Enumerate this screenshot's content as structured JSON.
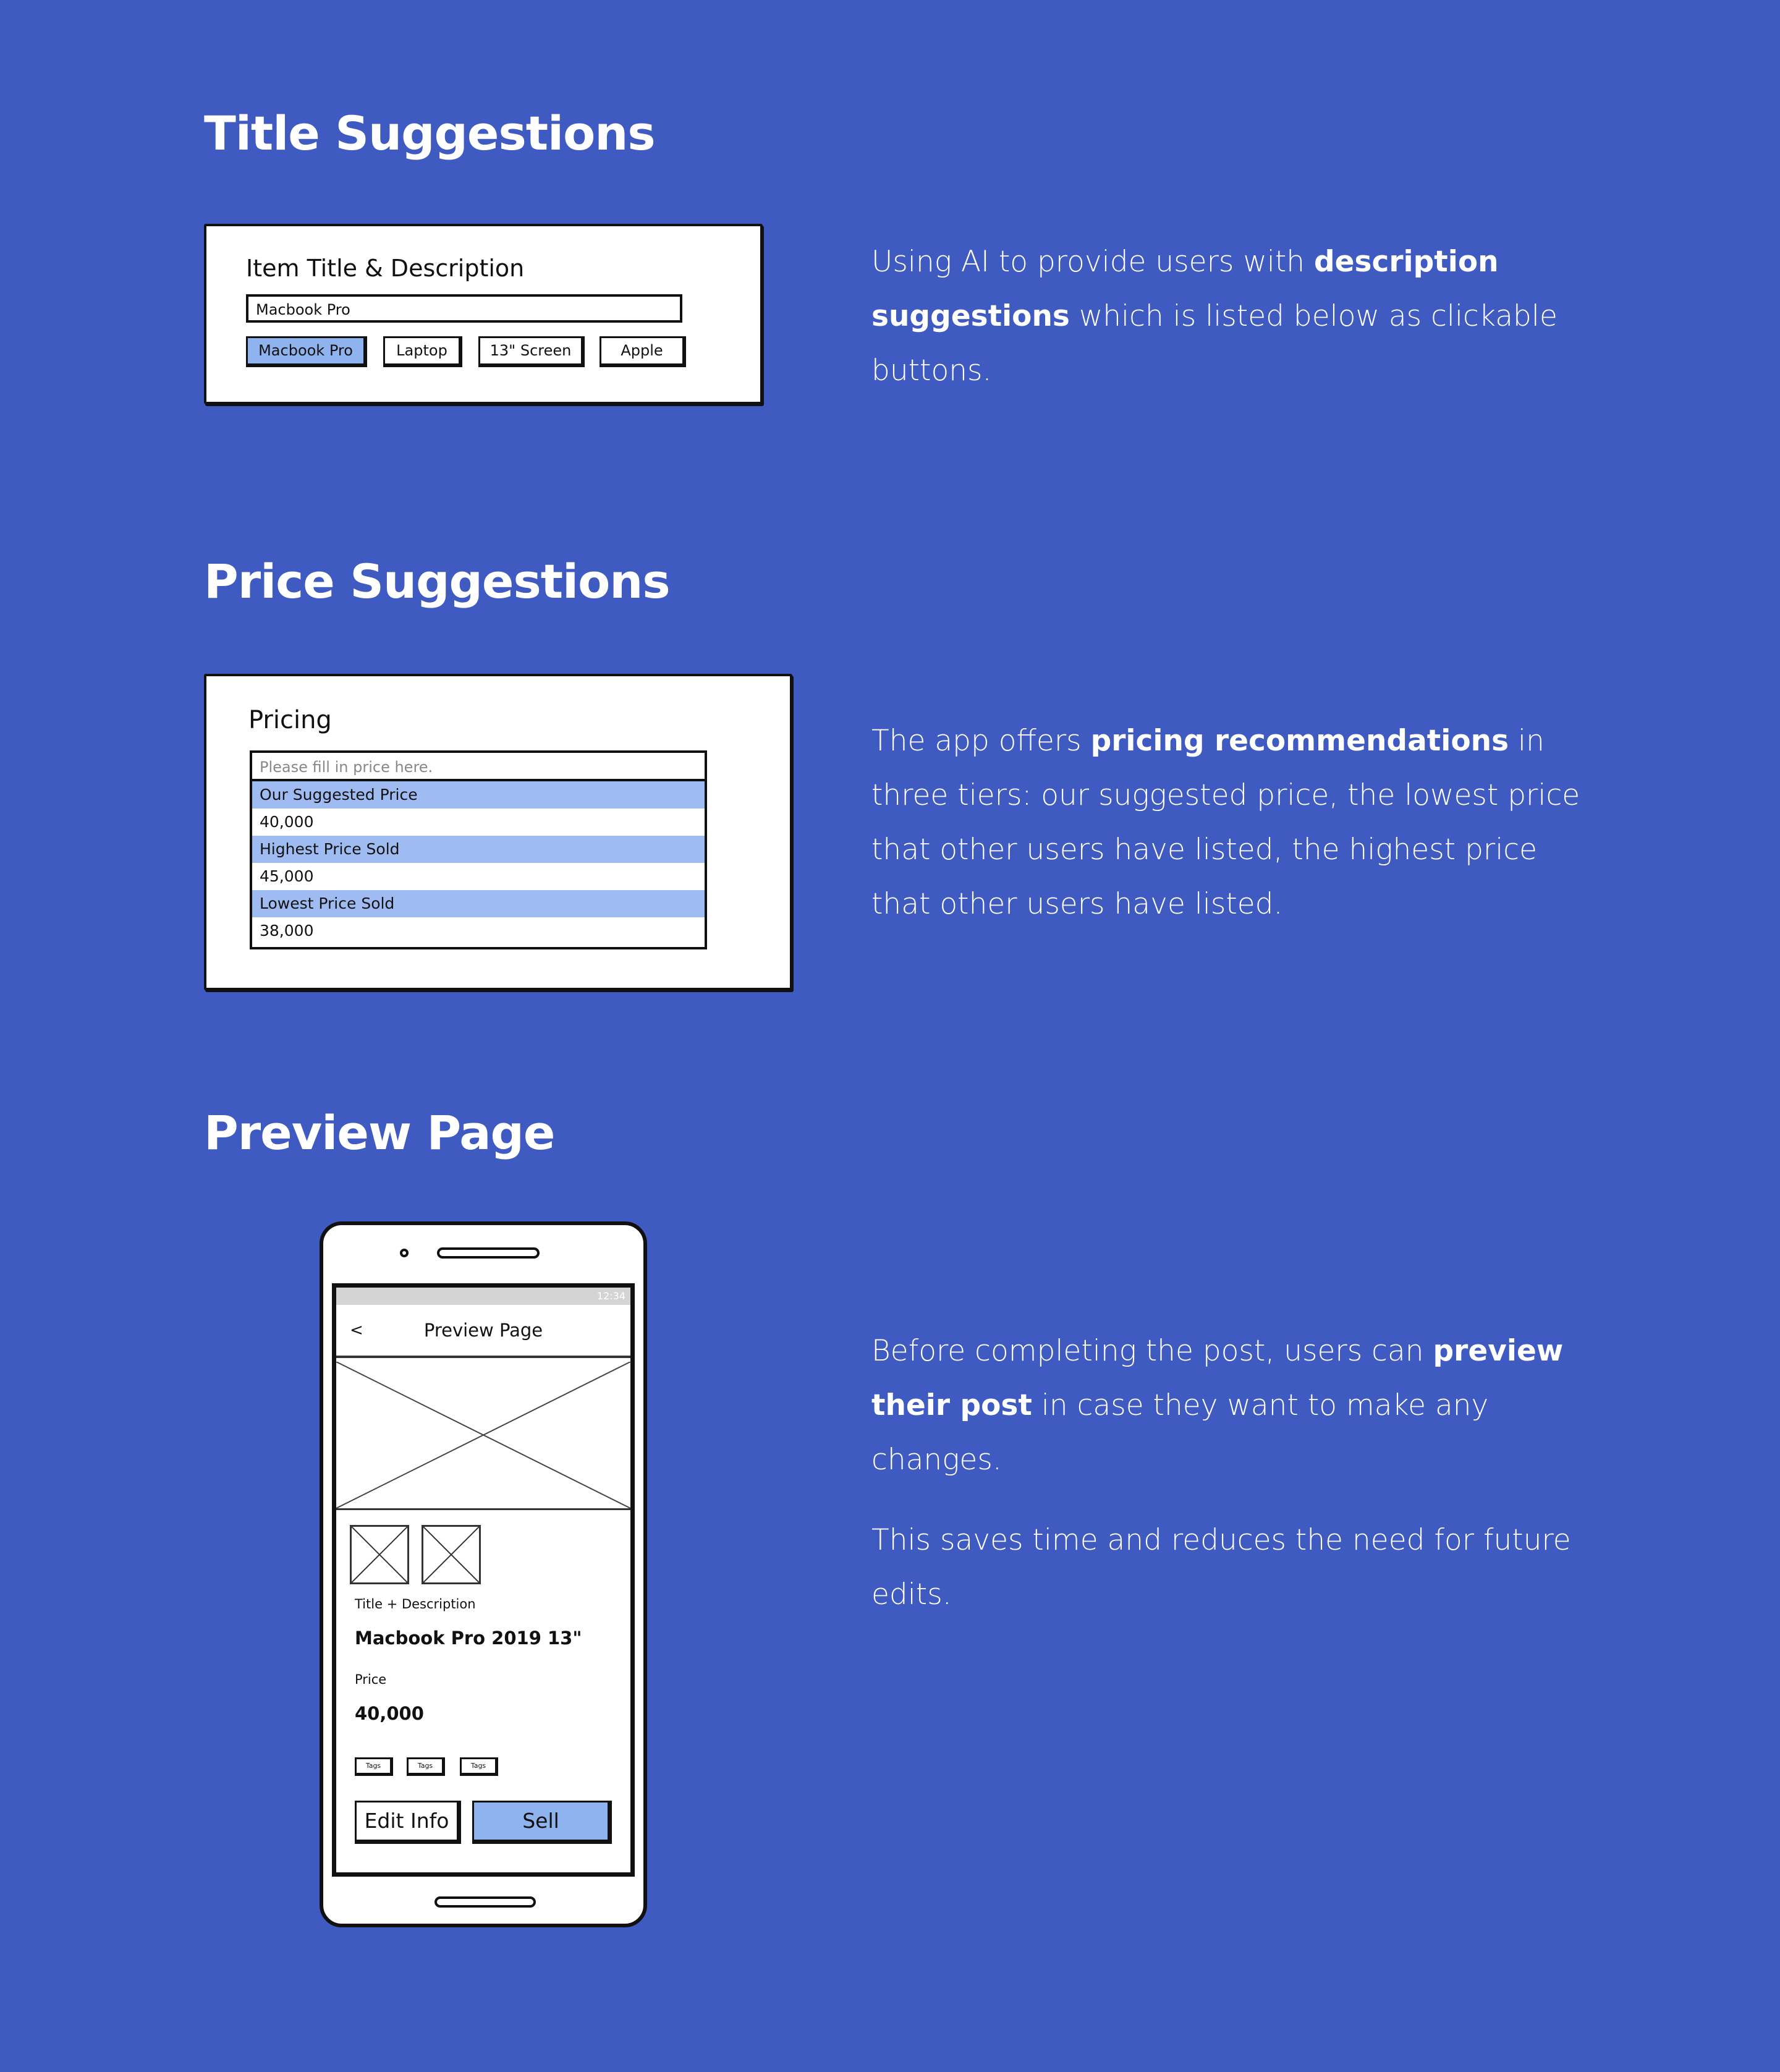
{
  "sections": {
    "title": {
      "heading": "Title Suggestions",
      "card_label": "Item Title & Description",
      "input_value": "Macbook Pro",
      "chips": [
        "Macbook Pro",
        "Laptop",
        "13\" Screen",
        "Apple"
      ],
      "desc_pre": "Using AI to provide users with ",
      "desc_bold": "description suggestions",
      "desc_post": " which is listed below as clickable buttons."
    },
    "price": {
      "heading": "Price Suggestions",
      "card_label": "Pricing",
      "input_placeholder": "Please fill in price here.",
      "rows": [
        {
          "label": "Our Suggested Price",
          "value": "40,000"
        },
        {
          "label": "Highest Price Sold",
          "value": "45,000"
        },
        {
          "label": "Lowest Price Sold",
          "value": "38,000"
        }
      ],
      "desc_pre": "The app offers ",
      "desc_bold": "pricing recommendations",
      "desc_post": " in three tiers: our suggested price, the lowest price that other users have listed, the highest price that other users have listed."
    },
    "preview": {
      "heading": "Preview Page",
      "status_time": "12:34",
      "appbar_back": "<",
      "appbar_title": "Preview Page",
      "title_label": "Title + Description",
      "title_value": "Macbook Pro 2019 13\"",
      "price_label": "Price",
      "price_value": "40,000",
      "tags": [
        "Tags",
        "Tags",
        "Tags"
      ],
      "edit_button": "Edit Info",
      "sell_button": "Sell",
      "desc_pre": "Before completing the post, users can ",
      "desc_bold": "preview their post",
      "desc_post": " in case they want to make any changes.",
      "desc_second": "This saves time and reduces the need for future edits."
    }
  },
  "colors": {
    "background": "#3f5bc2",
    "highlight": "#8fb3ef",
    "row_highlight": "#9ebcf2"
  }
}
